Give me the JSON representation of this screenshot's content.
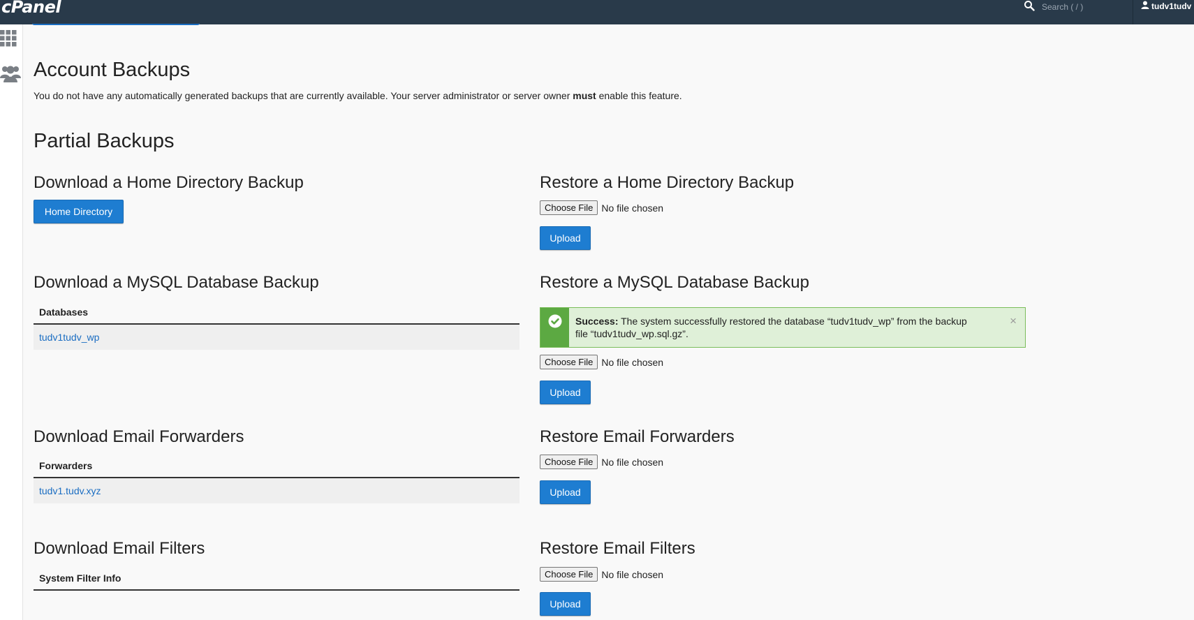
{
  "header": {
    "logo": "cPanel",
    "search_placeholder": "Search ( / )",
    "username": "tudv1tudv"
  },
  "account_backups": {
    "title": "Account Backups",
    "desc_before": "You do not have any automatically generated backups that are currently available. Your server administrator or server owner ",
    "desc_bold": "must",
    "desc_after": " enable this feature."
  },
  "partial_backups": {
    "title": "Partial Backups"
  },
  "home_download": {
    "title": "Download a Home Directory Backup",
    "button": "Home Directory"
  },
  "home_restore": {
    "title": "Restore a Home Directory Backup",
    "choose_label": "Choose File",
    "no_file": "No file chosen",
    "upload": "Upload"
  },
  "mysql_download": {
    "title": "Download a MySQL Database Backup",
    "column": "Databases",
    "rows": [
      "tudv1tudv_wp"
    ]
  },
  "mysql_restore": {
    "title": "Restore a MySQL Database Backup",
    "alert_bold": "Success:",
    "alert_text": " The system successfully restored the database “tudv1tudv_wp” from the backup file “tudv1tudv_wp.sql.gz”.",
    "alert_close": "×",
    "choose_label": "Choose File",
    "no_file": "No file chosen",
    "upload": "Upload"
  },
  "forwarders_download": {
    "title": "Download Email Forwarders",
    "column": "Forwarders",
    "rows": [
      "tudv1.tudv.xyz"
    ]
  },
  "forwarders_restore": {
    "title": "Restore Email Forwarders",
    "choose_label": "Choose File",
    "no_file": "No file chosen",
    "upload": "Upload"
  },
  "filters_download": {
    "title": "Download Email Filters",
    "column": "System Filter Info"
  },
  "filters_restore": {
    "title": "Restore Email Filters",
    "choose_label": "Choose File",
    "no_file": "No file chosen",
    "upload": "Upload"
  },
  "colors": {
    "topbar": "#293a4a",
    "primary_button": "#1e7dd1",
    "link": "#1a6dc2",
    "success_bg": "#dff0d8",
    "success_icon": "#5ca942"
  },
  "icons": {
    "search": "search-icon",
    "user": "user-icon",
    "apps": "grid-icon",
    "users": "users-icon",
    "success": "check-circle-icon"
  }
}
